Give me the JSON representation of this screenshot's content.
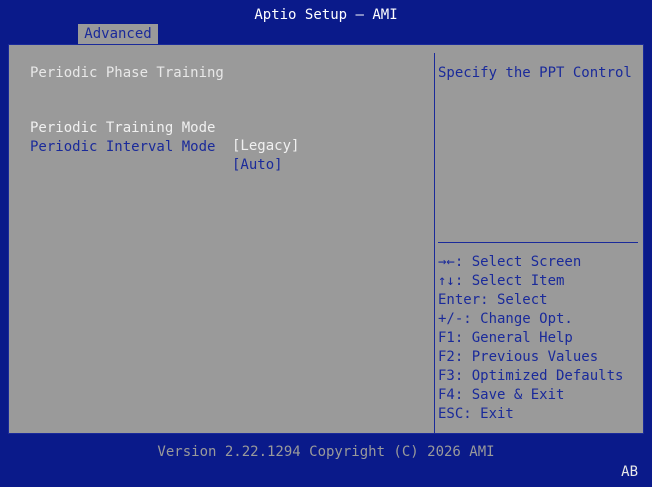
{
  "header": {
    "title": "Aptio Setup – AMI"
  },
  "tabs": [
    {
      "label": "Advanced"
    }
  ],
  "main": {
    "heading": "Periodic Phase Training",
    "items": [
      {
        "label": "Periodic Training Mode",
        "value": "[Legacy]"
      },
      {
        "label": "Periodic Interval Mode",
        "value": "[Auto]"
      }
    ]
  },
  "help": {
    "description": "Specify the PPT Control",
    "keys": [
      "→←: Select Screen",
      "↑↓: Select Item",
      "Enter: Select",
      "+/-: Change Opt.",
      "F1: General Help",
      "F2: Previous Values",
      "F3: Optimized Defaults",
      "F4: Save & Exit",
      "ESC: Exit"
    ]
  },
  "footer": {
    "version": "Version 2.22.1294 Copyright (C) 2026 AMI",
    "corner": "AB"
  },
  "colors": {
    "background_blue": "#0a1a8a",
    "panel_gray": "#9a9a9a",
    "accent_blue_text": "#1a2a9a",
    "highlight_white": "#f0f0f0"
  }
}
